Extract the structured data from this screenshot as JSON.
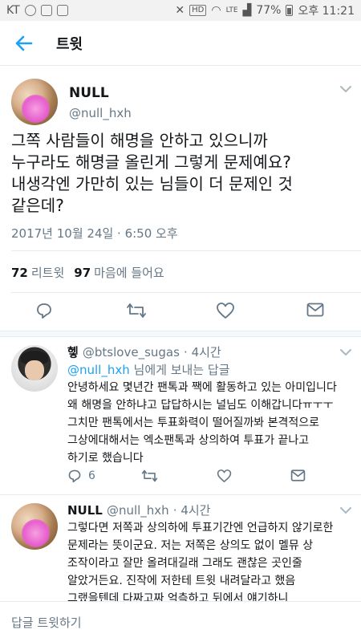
{
  "status_bar": {
    "carrier": "KT",
    "network": "LTE",
    "battery": "77%",
    "time": "오후 11:21"
  },
  "header": {
    "title": "트윗",
    "back_icon": "arrow-left-icon"
  },
  "main_tweet": {
    "name": "NULL",
    "handle": "@null_hxh",
    "text_lines": [
      "그쪽 사람들이 해명을 안하고 있으니까",
      "누구라도 해명글 올린게 그렇게 문제예요?",
      "내생각엔 가만히 있는 님들이 더 문제인 것",
      "같은데?"
    ],
    "timestamp": "2017년 10월 24일 · 6:50 오후",
    "retweet_count": "72",
    "retweet_label": "리트윗",
    "like_count": "97",
    "like_label": "마음에 들어요"
  },
  "replies": [
    {
      "name": "헿",
      "handle": "@btslove_sugas",
      "time": "· 4시간",
      "reply_to_handle": "@null_hxh",
      "reply_to_suffix": "님에게 보내는 답글",
      "lines": [
        "안녕하세요 몇년간 팬톡과 짹에 활동하고 있는 아미입니다",
        "왜 해명을 안하냐고 답답하시는 널님도 이해갑니다ㅠㅜㅜ",
        "그치만 팬톡에서는 투표화력이 떨어질까봐  본격적으로",
        "그상에대해서는 엑소팬톡과 상의하여 투표가 끝나고",
        "하기로 했습니다"
      ],
      "reply_count": "6"
    },
    {
      "name": "NULL",
      "handle": "@null_hxh",
      "time": "· 4시간",
      "lines": [
        "그렇다면 저쪽과 상의하에 투표기간엔 언급하지 않기로한",
        "문제라는 뜻이군요. 저는 저쪽은 상의도 없이 멜뮤 상",
        "조작이라고 잘만 올려대길래 그래도 괜찮은 곳인줄",
        "알았거든요. 진작에 저한테 트윗 내려달라고 했음",
        "그랬을텐데 다짜고짜 억측하고 뒤에서 얘기하니"
      ]
    }
  ],
  "reply_bar": {
    "placeholder": "답글 트윗하기"
  },
  "colors": {
    "accent": "#1da1f2",
    "text": "#14171a",
    "muted": "#657786",
    "divider": "#e6ecf0"
  }
}
